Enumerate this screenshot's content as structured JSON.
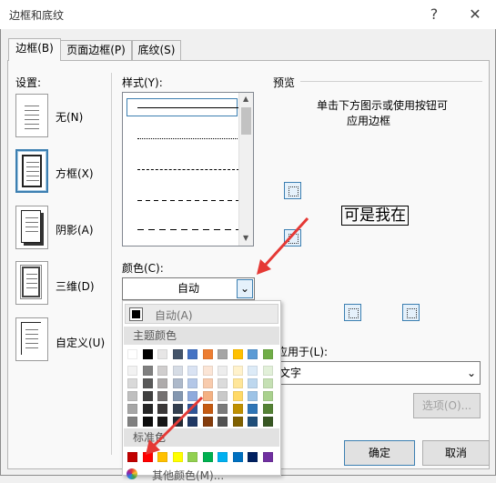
{
  "window": {
    "title": "边框和底纹",
    "help": "?",
    "close": "✕"
  },
  "tabs": [
    {
      "label": "边框(B)",
      "active": true
    },
    {
      "label": "页面边框(P)",
      "active": false
    },
    {
      "label": "底纹(S)",
      "active": false
    }
  ],
  "settings": {
    "label": "设置:",
    "items": [
      {
        "label": "无(N)",
        "selected": false
      },
      {
        "label": "方框(X)",
        "selected": true
      },
      {
        "label": "阴影(A)",
        "selected": false
      },
      {
        "label": "三维(D)",
        "selected": false
      },
      {
        "label": "自定义(U)",
        "selected": false
      }
    ]
  },
  "style": {
    "label": "样式(Y):",
    "options": [
      "solid",
      "dotted",
      "dashed-fine",
      "dashed",
      "dashed-long"
    ]
  },
  "color": {
    "label": "颜色(C):",
    "value": "自动"
  },
  "palette": {
    "auto_label": "自动(A)",
    "theme_header": "主题颜色",
    "standard_header": "标准色",
    "more_label": "其他颜色(M)...",
    "theme_top": [
      "#ffffff",
      "#000000",
      "#e7e6e6",
      "#44546a",
      "#4472c4",
      "#ed7d31",
      "#a5a5a5",
      "#ffc000",
      "#5b9bd5",
      "#70ad47"
    ],
    "theme_shades": [
      [
        "#f2f2f2",
        "#808080",
        "#d0cece",
        "#d6dce5",
        "#dae3f3",
        "#fbe5d6",
        "#ededed",
        "#fff2cc",
        "#ddebf7",
        "#e2f0d9"
      ],
      [
        "#d9d9d9",
        "#595959",
        "#aeabab",
        "#adb9ca",
        "#b4c7e7",
        "#f8cbad",
        "#dbdbdb",
        "#ffe699",
        "#bdd7ee",
        "#c5e0b4"
      ],
      [
        "#bfbfbf",
        "#404040",
        "#757171",
        "#8497b0",
        "#8faadc",
        "#f4b183",
        "#c9c9c9",
        "#ffd966",
        "#9dc3e6",
        "#a9d18e"
      ],
      [
        "#a6a6a6",
        "#262626",
        "#3b3838",
        "#333f50",
        "#2f5597",
        "#c55a11",
        "#7b7b7b",
        "#bf9000",
        "#2e75b6",
        "#548235"
      ],
      [
        "#808080",
        "#0d0d0d",
        "#171616",
        "#222a35",
        "#203864",
        "#843c0c",
        "#525252",
        "#7f6000",
        "#1f4e79",
        "#385723"
      ]
    ],
    "standard": [
      "#c00000",
      "#ff0000",
      "#ffc000",
      "#ffff00",
      "#92d050",
      "#00b050",
      "#00b0f0",
      "#0070c0",
      "#002060",
      "#7030a0"
    ]
  },
  "preview": {
    "label": "预览",
    "instruction_line1": "单击下方图示或使用按钮可",
    "instruction_line2": "应用边框",
    "sample_text": "可是我在"
  },
  "apply_to": {
    "label": "应用于(L):",
    "value": "文字"
  },
  "buttons": {
    "options": "选项(O)...",
    "ok": "确定",
    "cancel": "取消"
  },
  "colors": {
    "accent": "#3c7fb1",
    "arrow": "#e53935"
  }
}
